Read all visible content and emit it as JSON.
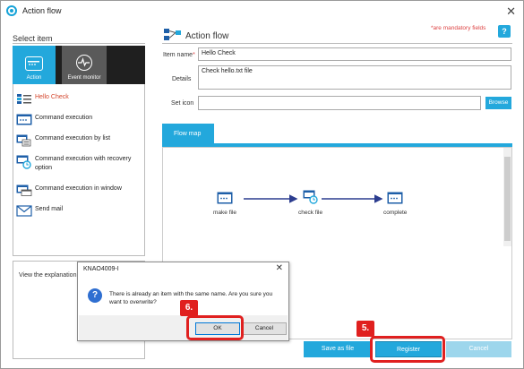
{
  "window": {
    "title": "Action flow",
    "close": "✕"
  },
  "left": {
    "title": "Select item",
    "tabs": [
      {
        "label": "Action"
      },
      {
        "label": "Event monitor"
      }
    ],
    "items": [
      {
        "label": "Hello Check",
        "icon": "action-list-icon",
        "selected": true
      },
      {
        "label": "Command execution",
        "icon": "command-icon"
      },
      {
        "label": "Command execution by list",
        "icon": "command-list-icon"
      },
      {
        "label": "Command execution with recovery option",
        "icon": "command-recovery-icon"
      },
      {
        "label": "Command execution in window",
        "icon": "command-window-icon"
      },
      {
        "label": "Send mail",
        "icon": "mail-icon"
      }
    ],
    "explain_text": "View the explanation"
  },
  "right": {
    "title": "Action flow",
    "mandatory": "*are mandatory fields",
    "help": "?",
    "fields": {
      "item_name_label": "Item name",
      "item_name_value": "Hello Check",
      "details_label": "Details",
      "details_value": "Check hello.txt file",
      "set_icon_label": "Set icon",
      "set_icon_value": "",
      "browse_label": "Browse",
      "required_mark": "*"
    },
    "flowmap": {
      "tab_label": "Flow map",
      "nodes": [
        {
          "label": "make file"
        },
        {
          "label": "check file"
        },
        {
          "label": "complete"
        }
      ]
    },
    "buttons": {
      "save_as": "Save as file",
      "register": "Register",
      "cancel": "Cancel"
    }
  },
  "dialog": {
    "title": "KNAO4009-I",
    "message": "There is already an item with the same name. Are you sure you want to overwrite?",
    "ok": "OK",
    "cancel": "Cancel",
    "icon_glyph": "?"
  },
  "callouts": [
    {
      "label": "6."
    },
    {
      "label": "5."
    }
  ],
  "colors": {
    "accent": "#23a8dc",
    "selected_text": "#d4462d",
    "callout": "#e0201f",
    "mandatory": "#dd4444"
  }
}
